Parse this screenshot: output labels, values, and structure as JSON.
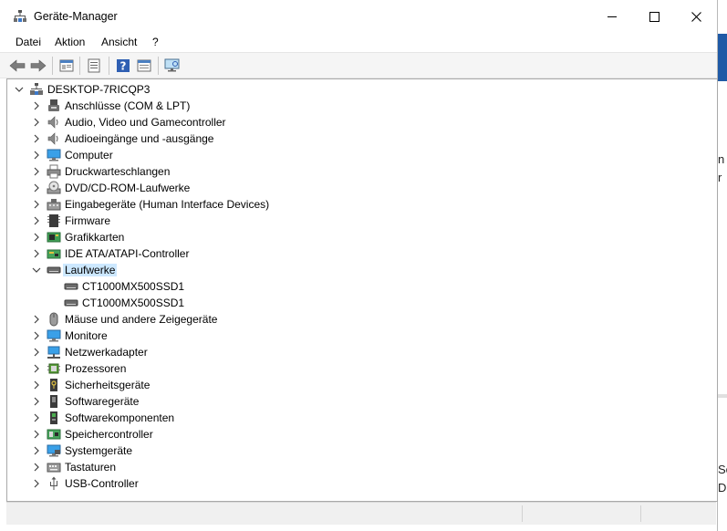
{
  "window": {
    "title": "Geräte-Manager",
    "minimize_label": "Minimieren",
    "maximize_label": "Maximieren",
    "close_label": "Schließen"
  },
  "menu": [
    "Datei",
    "Aktion",
    "Ansicht",
    "?"
  ],
  "toolbar": [
    "back-icon",
    "forward-icon",
    "properties-pane-icon",
    "list-view-icon",
    "help-icon",
    "details-view-icon",
    "monitor-scan-icon"
  ],
  "tree": {
    "root": "DESKTOP-7RICQP3",
    "categories": [
      {
        "label": "Anschlüsse (COM & LPT)",
        "icon": "port-icon"
      },
      {
        "label": "Audio, Video und Gamecontroller",
        "icon": "speaker-icon"
      },
      {
        "label": "Audioeingänge und -ausgänge",
        "icon": "speaker-icon"
      },
      {
        "label": "Computer",
        "icon": "computer-icon"
      },
      {
        "label": "Druckwarteschlangen",
        "icon": "printer-icon"
      },
      {
        "label": "DVD/CD-ROM-Laufwerke",
        "icon": "disc-drive-icon"
      },
      {
        "label": "Eingabegeräte (Human Interface Devices)",
        "icon": "hid-icon"
      },
      {
        "label": "Firmware",
        "icon": "firmware-icon"
      },
      {
        "label": "Grafikkarten",
        "icon": "graphics-card-icon"
      },
      {
        "label": "IDE ATA/ATAPI-Controller",
        "icon": "ide-controller-icon"
      },
      {
        "label": "Laufwerke",
        "icon": "disk-drive-icon",
        "expanded": true,
        "selected": true,
        "children": [
          "CT1000MX500SSD1",
          "CT1000MX500SSD1"
        ]
      },
      {
        "label": "Mäuse und andere Zeigegeräte",
        "icon": "mouse-icon"
      },
      {
        "label": "Monitore",
        "icon": "monitor-icon"
      },
      {
        "label": "Netzwerkadapter",
        "icon": "network-adapter-icon"
      },
      {
        "label": "Prozessoren",
        "icon": "processor-icon"
      },
      {
        "label": "Sicherheitsgeräte",
        "icon": "security-device-icon"
      },
      {
        "label": "Softwaregeräte",
        "icon": "software-device-icon"
      },
      {
        "label": "Softwarekomponenten",
        "icon": "software-component-icon"
      },
      {
        "label": "Speichercontroller",
        "icon": "storage-controller-icon"
      },
      {
        "label": "Systemgeräte",
        "icon": "system-device-icon"
      },
      {
        "label": "Tastaturen",
        "icon": "keyboard-icon"
      },
      {
        "label": "USB-Controller",
        "icon": "usb-icon"
      }
    ]
  },
  "background_text": [
    "n r",
    "r",
    "Sc",
    "Da"
  ],
  "colors": {
    "selection": "#cce8ff",
    "accent_blue": "#1f5aa6"
  }
}
